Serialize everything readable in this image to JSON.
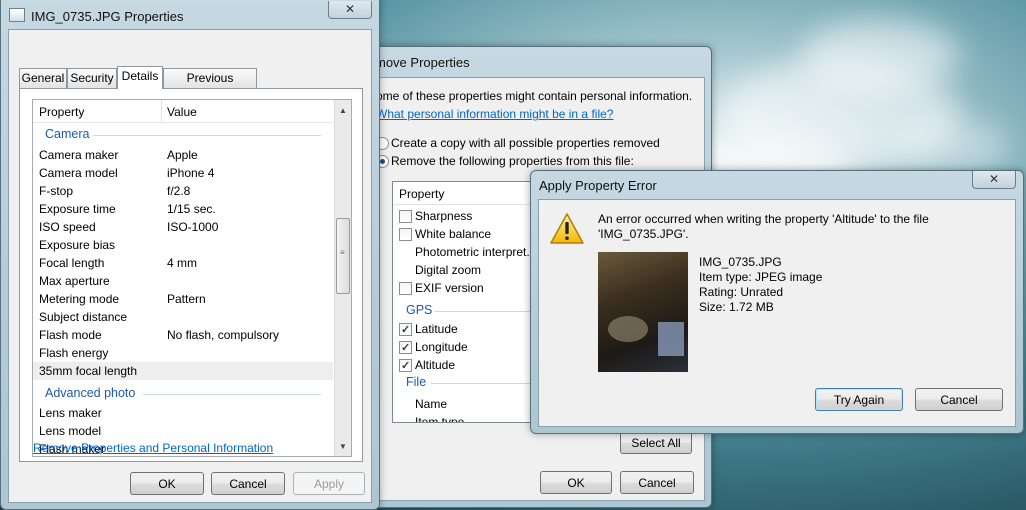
{
  "colors": {
    "link": "#0066cc",
    "group_header": "#1e5aa8",
    "desktop_teal": "#2a5c68"
  },
  "props_window": {
    "title": "IMG_0735.JPG Properties",
    "close_glyph": "✕",
    "tabs": [
      {
        "label": "General"
      },
      {
        "label": "Security"
      },
      {
        "label": "Details"
      },
      {
        "label": "Previous Versions"
      }
    ],
    "columns": {
      "property": "Property",
      "value": "Value"
    },
    "groups": {
      "camera": "Camera",
      "advanced": "Advanced photo"
    },
    "camera_rows": [
      {
        "name": "Camera maker",
        "value": "Apple"
      },
      {
        "name": "Camera model",
        "value": "iPhone 4"
      },
      {
        "name": "F-stop",
        "value": "f/2.8"
      },
      {
        "name": "Exposure time",
        "value": "1/15 sec."
      },
      {
        "name": "ISO speed",
        "value": "ISO-1000"
      },
      {
        "name": "Exposure bias",
        "value": ""
      },
      {
        "name": "Focal length",
        "value": "4 mm"
      },
      {
        "name": "Max aperture",
        "value": ""
      },
      {
        "name": "Metering mode",
        "value": "Pattern"
      },
      {
        "name": "Subject distance",
        "value": ""
      },
      {
        "name": "Flash mode",
        "value": "No flash, compulsory"
      },
      {
        "name": "Flash energy",
        "value": ""
      },
      {
        "name": "35mm focal length",
        "value": ""
      }
    ],
    "advanced_rows": [
      {
        "name": "Lens maker"
      },
      {
        "name": "Lens model"
      },
      {
        "name": "Flash maker"
      }
    ],
    "remove_link": "Remove Properties and Personal Information",
    "buttons": {
      "ok": "OK",
      "cancel": "Cancel",
      "apply": "Apply"
    }
  },
  "remove_window": {
    "title": "move Properties",
    "intro": "ome of these properties might contain personal information.",
    "info_link": "What personal information might be in a file?",
    "option_copy": "Create a copy with all possible properties removed",
    "option_remove": "Remove the following properties from this file:",
    "column": "Property",
    "rows": [
      {
        "label": "Sharpness",
        "has_check": true,
        "checked": false
      },
      {
        "label": "White balance",
        "has_check": true,
        "checked": false
      },
      {
        "label": "Photometric interpret...",
        "has_check": false,
        "checked": false
      },
      {
        "label": "Digital zoom",
        "has_check": false,
        "checked": false
      },
      {
        "label": "EXIF version",
        "has_check": true,
        "checked": false
      }
    ],
    "gps_group": "GPS",
    "gps_rows": [
      {
        "label": "Latitude",
        "checked": true
      },
      {
        "label": "Longitude",
        "checked": true
      },
      {
        "label": "Altitude",
        "checked": true
      }
    ],
    "file_group": "File",
    "file_rows": [
      {
        "label": "Name"
      },
      {
        "label": "Item type"
      }
    ],
    "buttons": {
      "select_all": "Select All",
      "ok": "OK",
      "cancel": "Cancel"
    }
  },
  "error_dialog": {
    "title": "Apply Property Error",
    "close_glyph": "✕",
    "message_line1": "An error occurred when writing the property 'Altitude' to the file",
    "message_line2": "'IMG_0735.JPG'.",
    "file_name": "IMG_0735.JPG",
    "item_type": "Item type: JPEG image",
    "rating": "Rating: Unrated",
    "size": "Size: 1.72 MB",
    "buttons": {
      "try_again": "Try Again",
      "cancel": "Cancel"
    }
  }
}
